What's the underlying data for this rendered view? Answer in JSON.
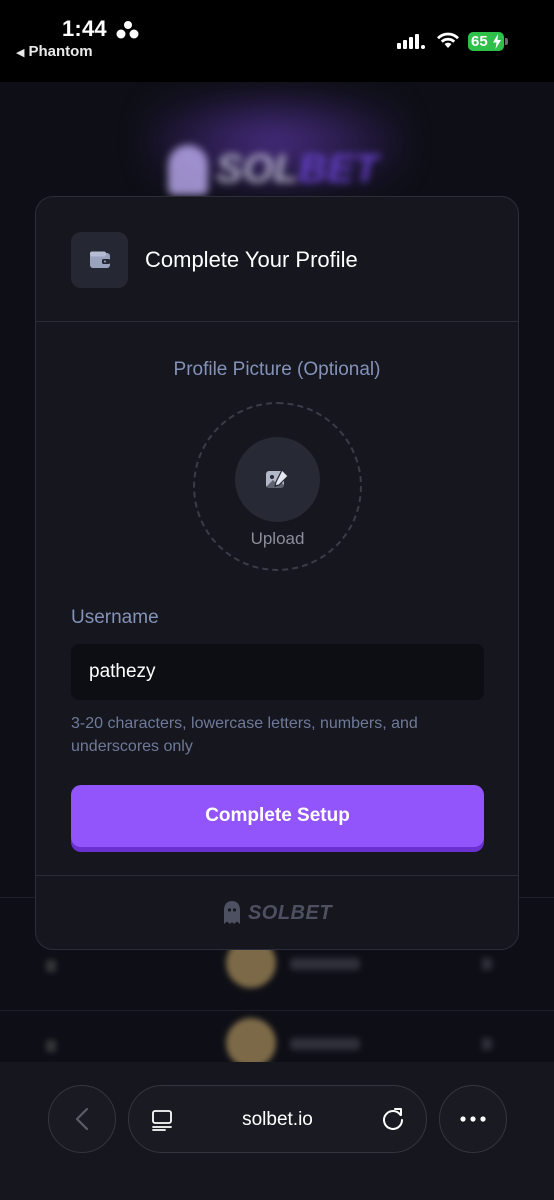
{
  "status_bar": {
    "time": "1:44",
    "back_app": "Phantom",
    "battery_percent": "65",
    "battery_charging": true,
    "icons": [
      "focus-icon",
      "signal-icon",
      "wifi-icon",
      "battery-icon"
    ]
  },
  "modal": {
    "title": "Complete Your Profile",
    "header_icon": "wallet-icon",
    "picture_label": "Profile Picture (Optional)",
    "upload_label": "Upload",
    "upload_icon": "image-edit-icon",
    "username_label": "Username",
    "username_value": "pathezy",
    "username_hint": "3-20 characters, lowercase letters, numbers, and underscores only",
    "submit_label": "Complete Setup",
    "footer_brand": "SOLBET",
    "footer_icon": "ghost-icon"
  },
  "browser": {
    "url": "solbet.io",
    "icons": [
      "back-arrow-icon",
      "tabs-icon",
      "reload-icon",
      "more-icon"
    ]
  },
  "colors": {
    "accent": "#9155fb",
    "background": "#0c0d13",
    "modal_bg": "#15161e",
    "muted_label": "#8492b8",
    "battery_green": "#2fc04a"
  }
}
